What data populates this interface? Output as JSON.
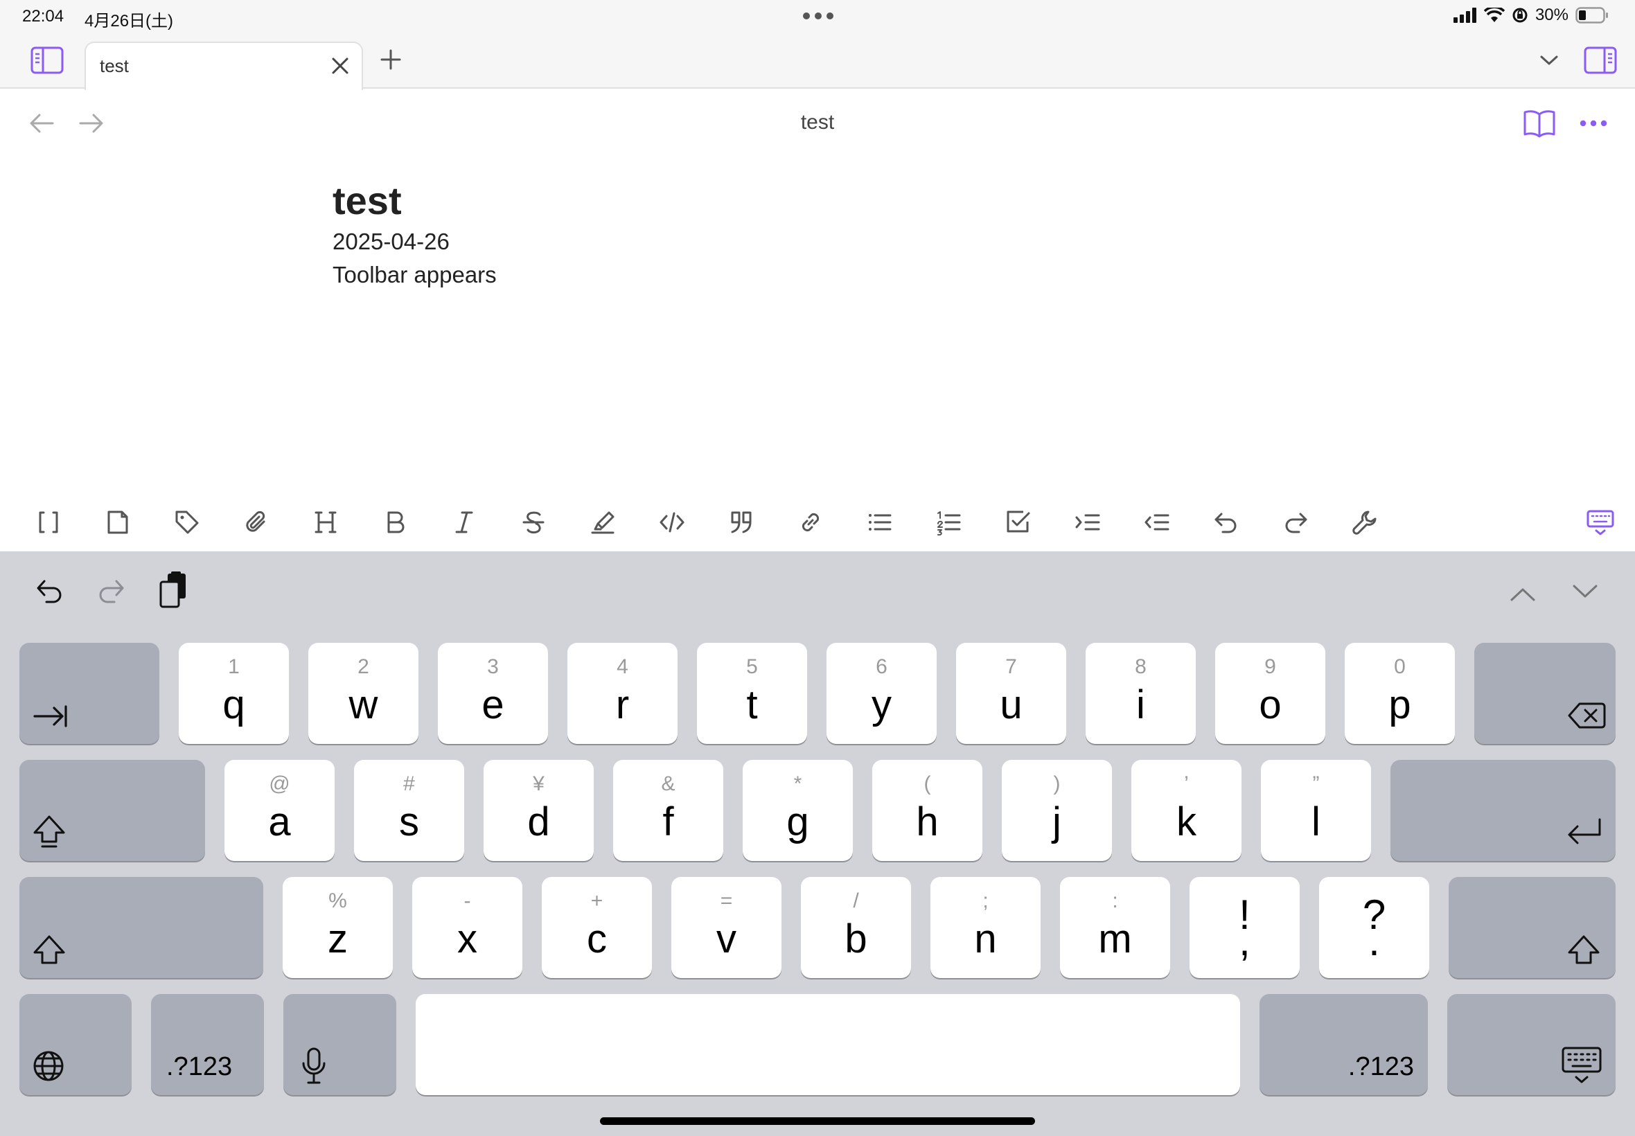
{
  "status_bar": {
    "time": "22:04",
    "date": "4月26日(土)",
    "battery": "30%"
  },
  "tab_bar": {
    "tab_title": "test"
  },
  "header": {
    "title": "test"
  },
  "note": {
    "heading": "test",
    "lines": [
      "2025-04-26",
      "Toolbar appears"
    ]
  },
  "toolbar": {
    "items": [
      "wikilink",
      "new-note",
      "tag",
      "attachment",
      "heading",
      "bold",
      "italic",
      "strikethrough",
      "highlight",
      "code",
      "quote",
      "link",
      "bullet-list",
      "numbered-list",
      "checklist",
      "indent",
      "outdent",
      "undo",
      "redo",
      "settings"
    ],
    "accent_color": "#8a5cf5"
  },
  "keyboard": {
    "row1": [
      {
        "hint": "1",
        "char": "q"
      },
      {
        "hint": "2",
        "char": "w"
      },
      {
        "hint": "3",
        "char": "e"
      },
      {
        "hint": "4",
        "char": "r"
      },
      {
        "hint": "5",
        "char": "t"
      },
      {
        "hint": "6",
        "char": "y"
      },
      {
        "hint": "7",
        "char": "u"
      },
      {
        "hint": "8",
        "char": "i"
      },
      {
        "hint": "9",
        "char": "o"
      },
      {
        "hint": "0",
        "char": "p"
      }
    ],
    "row2": [
      {
        "hint": "@",
        "char": "a"
      },
      {
        "hint": "#",
        "char": "s"
      },
      {
        "hint": "¥",
        "char": "d"
      },
      {
        "hint": "&",
        "char": "f"
      },
      {
        "hint": "*",
        "char": "g"
      },
      {
        "hint": "(",
        "char": "h"
      },
      {
        "hint": ")",
        "char": "j"
      },
      {
        "hint": "’",
        "char": "k"
      },
      {
        "hint": "”",
        "char": "l"
      }
    ],
    "row3": [
      {
        "hint": "%",
        "char": "z"
      },
      {
        "hint": "-",
        "char": "x"
      },
      {
        "hint": "+",
        "char": "c"
      },
      {
        "hint": "=",
        "char": "v"
      },
      {
        "hint": "/",
        "char": "b"
      },
      {
        "hint": ";",
        "char": "n"
      },
      {
        "hint": ":",
        "char": "m"
      },
      {
        "hint": "!",
        "char": ","
      },
      {
        "hint": "?",
        "char": "."
      }
    ],
    "numbers_label": ".?123"
  }
}
